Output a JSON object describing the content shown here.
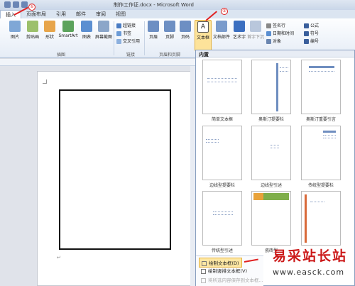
{
  "window": {
    "title": "制作工作证.docx - Microsoft Word"
  },
  "tabs": [
    "插入",
    "页面布局",
    "引用",
    "邮件",
    "审阅",
    "视图"
  ],
  "ribbon": {
    "buttons": [
      "图片",
      "剪贴画",
      "形状",
      "SmartArt",
      "图表",
      "屏幕截图",
      "页眉",
      "页脚",
      "页码",
      "文本框",
      "文档部件",
      "艺术字",
      "首字下沉"
    ],
    "links": [
      "超链接",
      "书签",
      "交叉引用"
    ],
    "right": [
      "签名行",
      "日期和时间",
      "对象",
      "公式",
      "符号",
      "编号"
    ],
    "groups": [
      "插图",
      "链接",
      "页眉和页脚"
    ]
  },
  "gallery": {
    "section": "内置",
    "items": [
      "简单文本框",
      "奥斯汀提要栏",
      "奥斯汀重要引言",
      "边线型提要栏",
      "边线型引述",
      "传统型提要栏",
      "传统型引述",
      "瓷砖型",
      ""
    ]
  },
  "menu": {
    "draw": "绘制文本框(D)",
    "draw_vertical": "绘制竖排文本框(V)",
    "save": "将所选内容保存到文本框..."
  },
  "annotations": {
    "one": "①",
    "two": "②"
  },
  "watermark": {
    "chinese": "易采站长站",
    "url": "www.easck.com"
  },
  "colors": {
    "accent": "#e02020",
    "highlight": "#fde39a"
  }
}
